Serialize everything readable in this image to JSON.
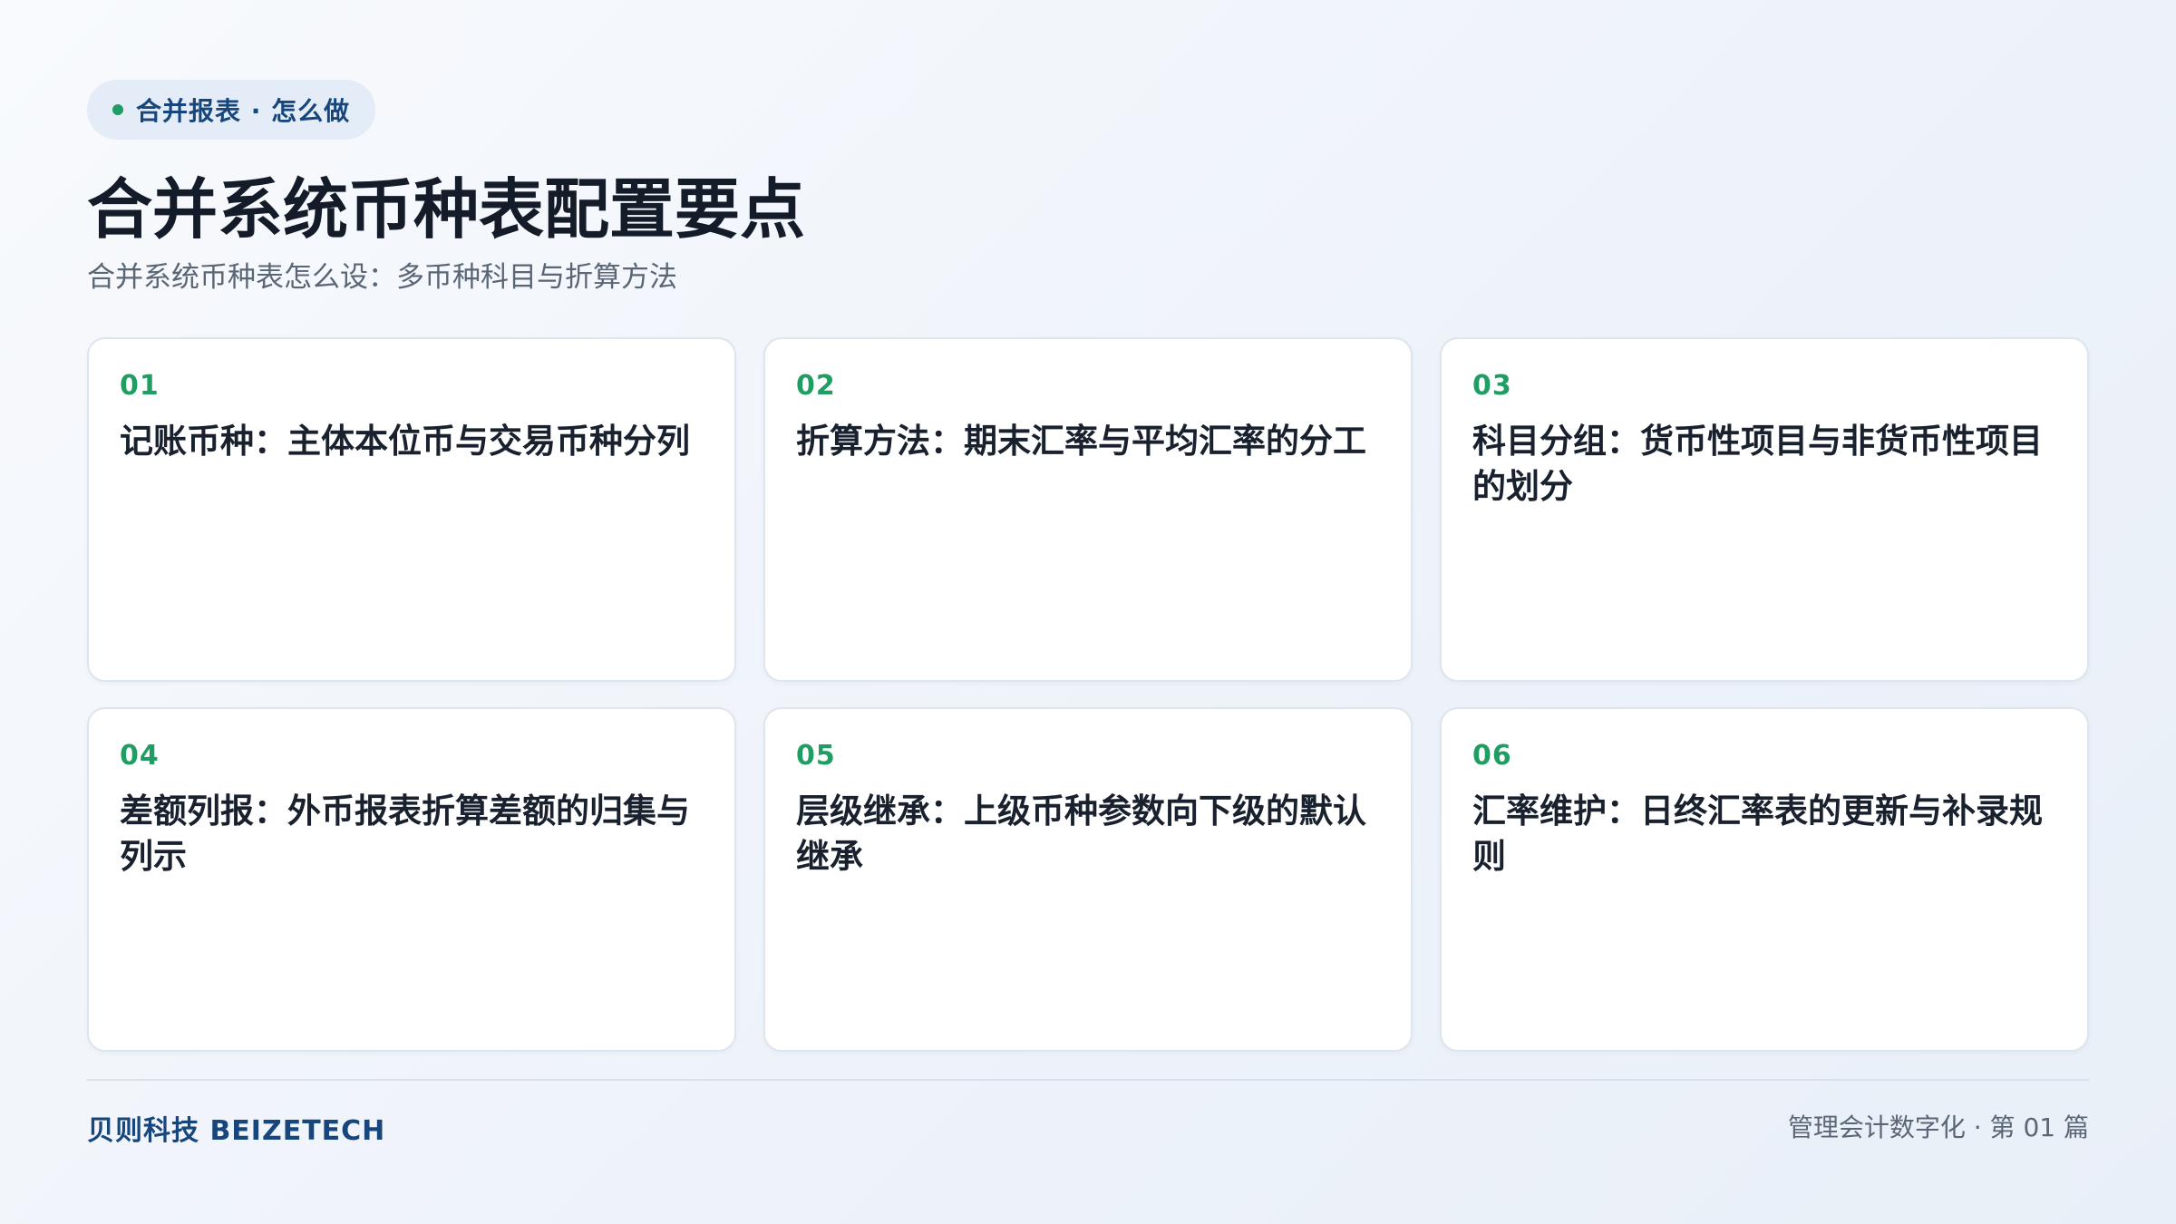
{
  "header": {
    "tag": "合并报表 · 怎么做",
    "title": "合并系统币种表配置要点",
    "subtitle": "合并系统币种表怎么设：多币种科目与折算方法"
  },
  "cards": [
    {
      "num": "01",
      "text": "记账币种：主体本位币与交易币种分列"
    },
    {
      "num": "02",
      "text": "折算方法：期末汇率与平均汇率的分工"
    },
    {
      "num": "03",
      "text": "科目分组：货币性项目与非货币性项目的划分"
    },
    {
      "num": "04",
      "text": "差额列报：外币报表折算差额的归集与列示"
    },
    {
      "num": "05",
      "text": "层级继承：上级币种参数向下级的默认继承"
    },
    {
      "num": "06",
      "text": "汇率维护：日终汇率表的更新与补录规则"
    }
  ],
  "footer": {
    "brand": "贝则科技 BEIZETECH",
    "series": "管理会计数字化 · 第 01 篇"
  },
  "colors": {
    "accent_green": "#1f9d63",
    "brand_blue": "#17467d",
    "background": "#f3f6fb"
  }
}
